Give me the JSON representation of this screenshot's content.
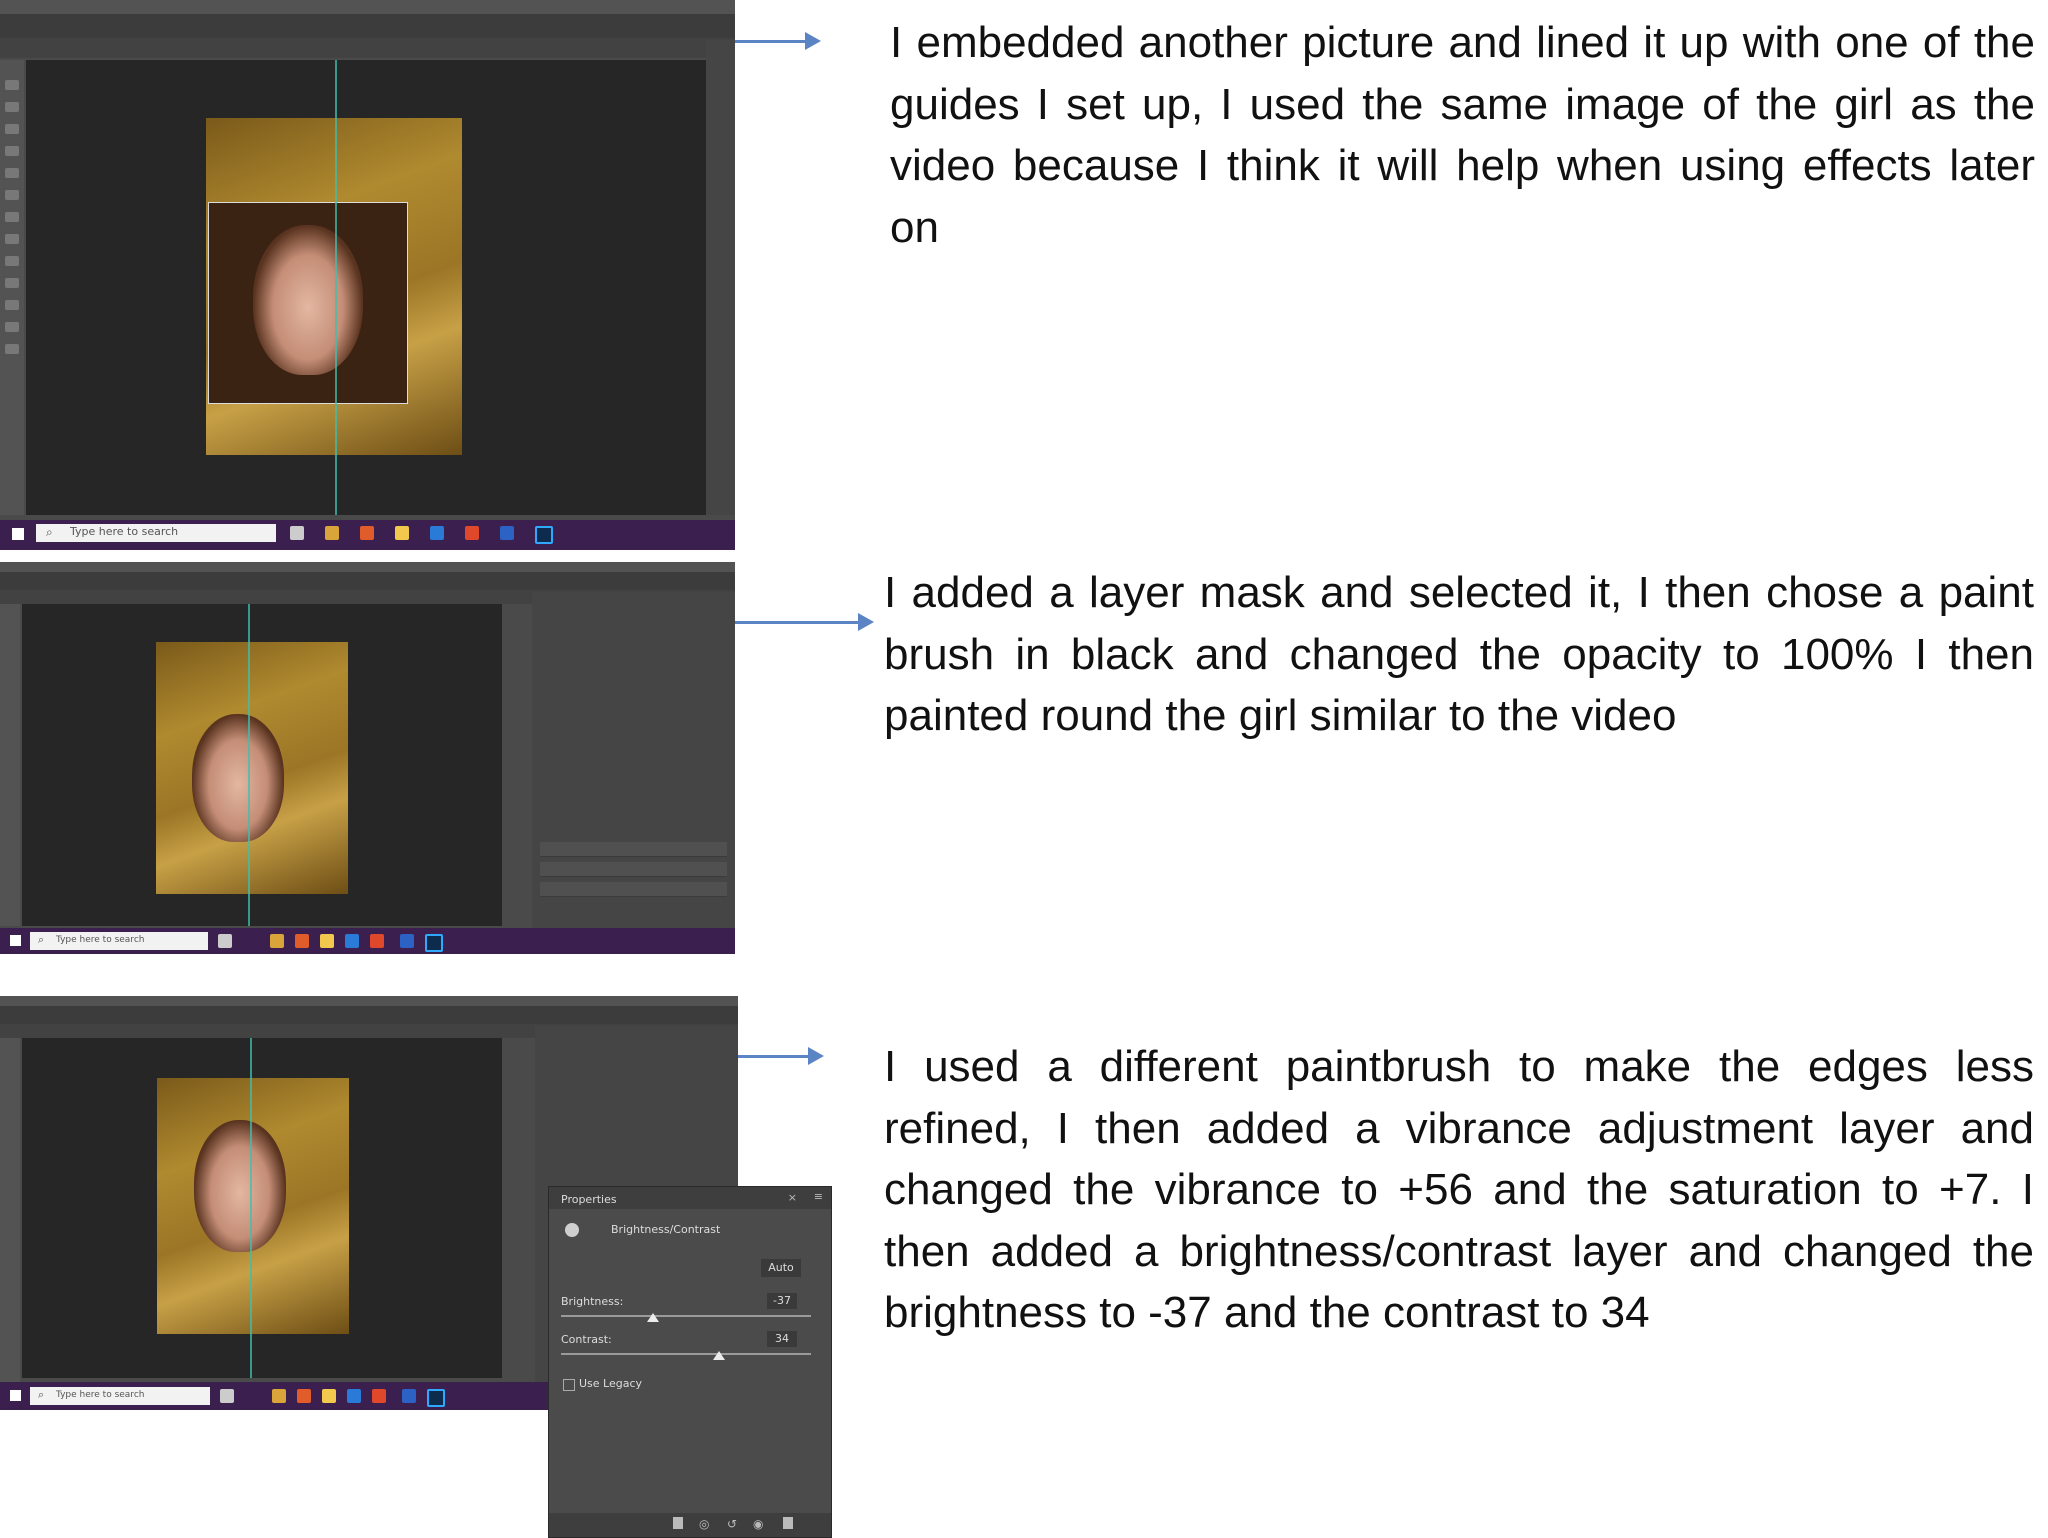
{
  "steps": [
    {
      "caption": "I embedded another picture and lined it up with one of the guides I set up, I used the same image of the girl as the video because I think it will help when using effects later on"
    },
    {
      "caption": "I added a layer mask and selected it, I then chose a paint brush in black and changed the opacity to 100% I then painted round the girl similar to the video"
    },
    {
      "caption": "I used a different paintbrush to make the edges less refined, I then added a vibrance adjustment layer and changed the vibrance to +56 and the saturation to +7. I then added a brightness/contrast layer and changed the brightness to -37 and the contrast to 34"
    }
  ],
  "taskbar": {
    "search_placeholder": "Type here to search"
  },
  "properties_panel": {
    "title": "Properties",
    "adjustment": "Brightness/Contrast",
    "auto_label": "Auto",
    "brightness_label": "Brightness:",
    "brightness_value": "-37",
    "contrast_label": "Contrast:",
    "contrast_value": "34",
    "legacy_label": "Use Legacy"
  },
  "colors": {
    "arrow": "#5b84c4",
    "photoshop_bg": "#262626",
    "taskbar": "#3a1f4f",
    "guide": "#3fbfae"
  },
  "icons": [
    "windows-start-icon",
    "search-icon",
    "photoshop-icon",
    "arrow-right-icon"
  ]
}
